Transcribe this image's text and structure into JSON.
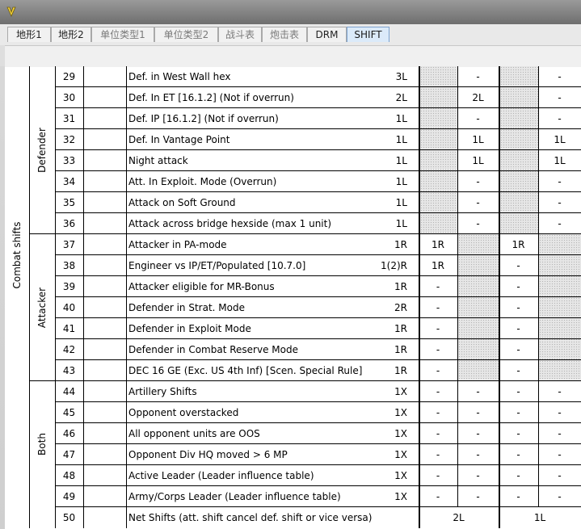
{
  "tabs": [
    {
      "label": "地形1",
      "active": false,
      "dim": false
    },
    {
      "label": "地形2",
      "active": false,
      "dim": false
    },
    {
      "label": "单位类型1",
      "active": false,
      "dim": true
    },
    {
      "label": "单位类型2",
      "active": false,
      "dim": true
    },
    {
      "label": "战斗表",
      "active": false,
      "dim": true
    },
    {
      "label": "炮击表",
      "active": false,
      "dim": true
    },
    {
      "label": "DRM",
      "active": false,
      "dim": false
    },
    {
      "label": "SHIFT",
      "active": true,
      "dim": false
    }
  ],
  "table": {
    "section_label": "Combat shifts",
    "groups": [
      {
        "label": "Defender",
        "first_row": 0,
        "row_count": 8
      },
      {
        "label": "Attacker",
        "first_row": 8,
        "row_count": 7
      },
      {
        "label": "Both",
        "first_row": 15,
        "row_count": 6
      }
    ],
    "rows": [
      {
        "num": "29",
        "desc": "Def. in West Wall hex",
        "shift": "3L",
        "c1": "",
        "c2": "-",
        "c3": "",
        "c4": "-"
      },
      {
        "num": "30",
        "desc": "Def. In ET [16.1.2] (Not if overrun)",
        "shift": "2L",
        "c1": "",
        "c2": "2L",
        "c3": "",
        "c4": "-"
      },
      {
        "num": "31",
        "desc": "Def. IP [16.1.2] (Not if overrun)",
        "shift": "1L",
        "c1": "",
        "c2": "-",
        "c3": "",
        "c4": "-"
      },
      {
        "num": "32",
        "desc": "Def. In Vantage Point",
        "shift": "1L",
        "c1": "",
        "c2": "1L",
        "c3": "",
        "c4": "1L"
      },
      {
        "num": "33",
        "desc": "Night attack",
        "shift": "1L",
        "c1": "",
        "c2": "1L",
        "c3": "",
        "c4": "1L"
      },
      {
        "num": "34",
        "desc": "Att. In Exploit. Mode (Overrun)",
        "shift": "1L",
        "c1": "",
        "c2": "-",
        "c3": "",
        "c4": "-"
      },
      {
        "num": "35",
        "desc": "Attack on Soft Ground",
        "shift": "1L",
        "c1": "",
        "c2": "-",
        "c3": "",
        "c4": "-"
      },
      {
        "num": "36",
        "desc": "Attack across bridge hexside (max 1 unit)",
        "shift": "1L",
        "c1": "",
        "c2": "-",
        "c3": "",
        "c4": "-"
      },
      {
        "num": "37",
        "desc": "Attacker in PA-mode",
        "shift": "1R",
        "c1": "1R",
        "c2": "",
        "c3": "1R",
        "c4": ""
      },
      {
        "num": "38",
        "desc": "Engineer vs IP/ET/Populated [10.7.0]",
        "shift": "1(2)R",
        "c1": "1R",
        "c2": "",
        "c3": "-",
        "c4": ""
      },
      {
        "num": "39",
        "desc": "Attacker eligible for MR-Bonus",
        "shift": "1R",
        "c1": "-",
        "c2": "",
        "c3": "-",
        "c4": ""
      },
      {
        "num": "40",
        "desc": "Defender in Strat. Mode",
        "shift": "2R",
        "c1": "-",
        "c2": "",
        "c3": "-",
        "c4": ""
      },
      {
        "num": "41",
        "desc": "Defender in Exploit Mode",
        "shift": "1R",
        "c1": "-",
        "c2": "",
        "c3": "-",
        "c4": ""
      },
      {
        "num": "42",
        "desc": "Defender in Combat Reserve Mode",
        "shift": "1R",
        "c1": "-",
        "c2": "",
        "c3": "-",
        "c4": ""
      },
      {
        "num": "43",
        "desc": "DEC 16 GE (Exc. US 4th Inf) [Scen. Special Rule]",
        "shift": "1R",
        "c1": "-",
        "c2": "",
        "c3": "-",
        "c4": ""
      },
      {
        "num": "44",
        "desc": "Artillery Shifts",
        "shift": "1X",
        "c1": "-",
        "c2": "-",
        "c3": "-",
        "c4": "-"
      },
      {
        "num": "45",
        "desc": "Opponent overstacked",
        "shift": "1X",
        "c1": "-",
        "c2": "-",
        "c3": "-",
        "c4": "-"
      },
      {
        "num": "46",
        "desc": "All opponent units are OOS",
        "shift": "1X",
        "c1": "-",
        "c2": "-",
        "c3": "-",
        "c4": "-"
      },
      {
        "num": "47",
        "desc": "Opponent Div HQ moved > 6 MP",
        "shift": "1X",
        "c1": "-",
        "c2": "-",
        "c3": "-",
        "c4": "-"
      },
      {
        "num": "48",
        "desc": "Active Leader (Leader influence table)",
        "shift": "1X",
        "c1": "-",
        "c2": "-",
        "c3": "-",
        "c4": "-"
      },
      {
        "num": "49",
        "desc": "Army/Corps Leader (Leader influence table)",
        "shift": "1X",
        "c1": "-",
        "c2": "-",
        "c3": "-",
        "c4": "-"
      }
    ],
    "total": {
      "num": "50",
      "desc": "Net Shifts (att. shift cancel def. shift or vice versa)",
      "left_value": "2L",
      "right_value": "1L"
    }
  }
}
